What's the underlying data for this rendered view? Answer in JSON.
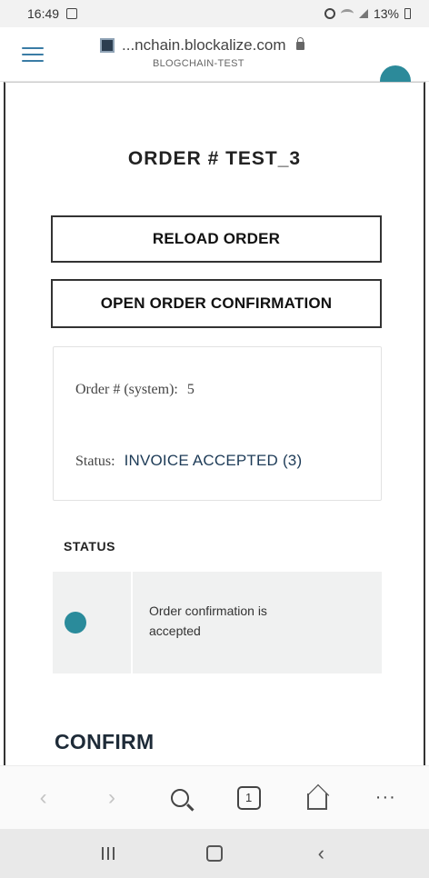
{
  "status_bar": {
    "time": "16:49",
    "battery": "13%"
  },
  "browser": {
    "url": "...nchain.blockalize.com",
    "site_subtitle": "BLOGCHAIN-TEST"
  },
  "page": {
    "title": "ORDER # TEST_3",
    "buttons": {
      "reload": "RELOAD ORDER",
      "open_confirmation": "OPEN ORDER CONFIRMATION"
    },
    "info": {
      "order_label": "Order # (system):",
      "order_value": "5",
      "status_label": "Status:",
      "status_value": "INVOICE ACCEPTED (3)"
    },
    "status_section": {
      "heading": "STATUS",
      "rows": [
        {
          "message_line1": "Order confirmation is",
          "message_line2": "accepted",
          "dot_color": "#2a8b9b"
        }
      ]
    },
    "confirm_heading": "CONFIRM"
  },
  "toolbar": {
    "tab_count": "1",
    "icons": [
      "back-icon",
      "forward-icon",
      "search-icon",
      "tabs-icon",
      "home-icon",
      "more-icon"
    ]
  },
  "nav": {
    "icons": [
      "recents-icon",
      "home-icon",
      "back-icon"
    ]
  },
  "colors": {
    "accent": "#2a8b9b",
    "menu": "#3a7ca5",
    "status_text": "#1d3b57"
  }
}
